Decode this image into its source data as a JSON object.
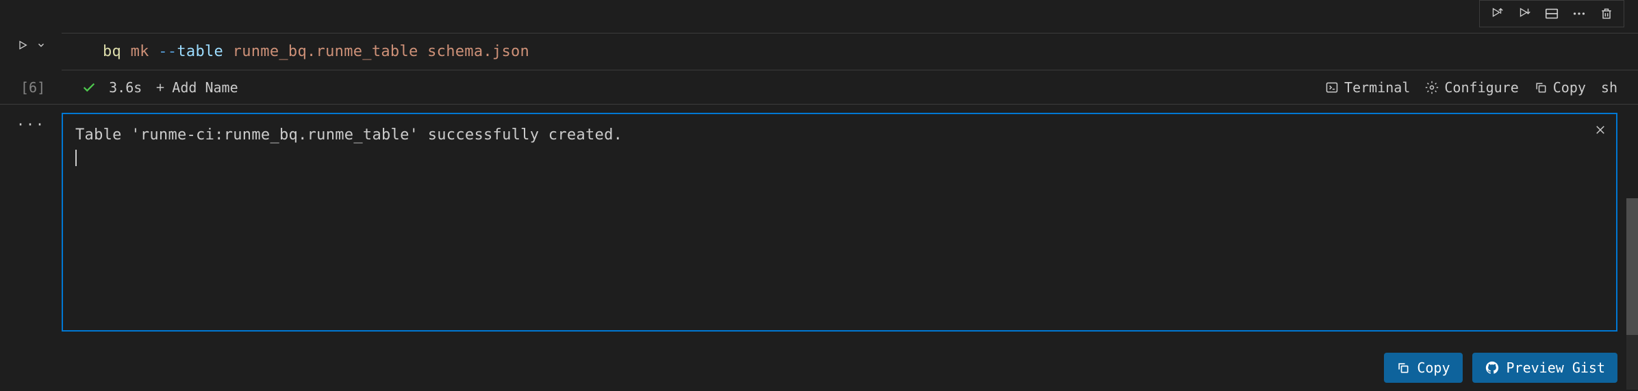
{
  "cell": {
    "exec_count": "[6]",
    "code": {
      "cmd": "bq",
      "sub": "mk",
      "flag_dashes": "--",
      "flag_name": "table",
      "arg1": "runme_bq.runme_table",
      "arg2": "schema.json"
    }
  },
  "status": {
    "duration": "3.6s",
    "add_name_label": "Add Name",
    "terminal_label": "Terminal",
    "configure_label": "Configure",
    "copy_label": "Copy",
    "lang_label": "sh"
  },
  "output": {
    "text": "Table 'runme-ci:runme_bq.runme_table' successfully created."
  },
  "buttons": {
    "copy_label": "Copy",
    "preview_gist_label": "Preview Gist"
  }
}
